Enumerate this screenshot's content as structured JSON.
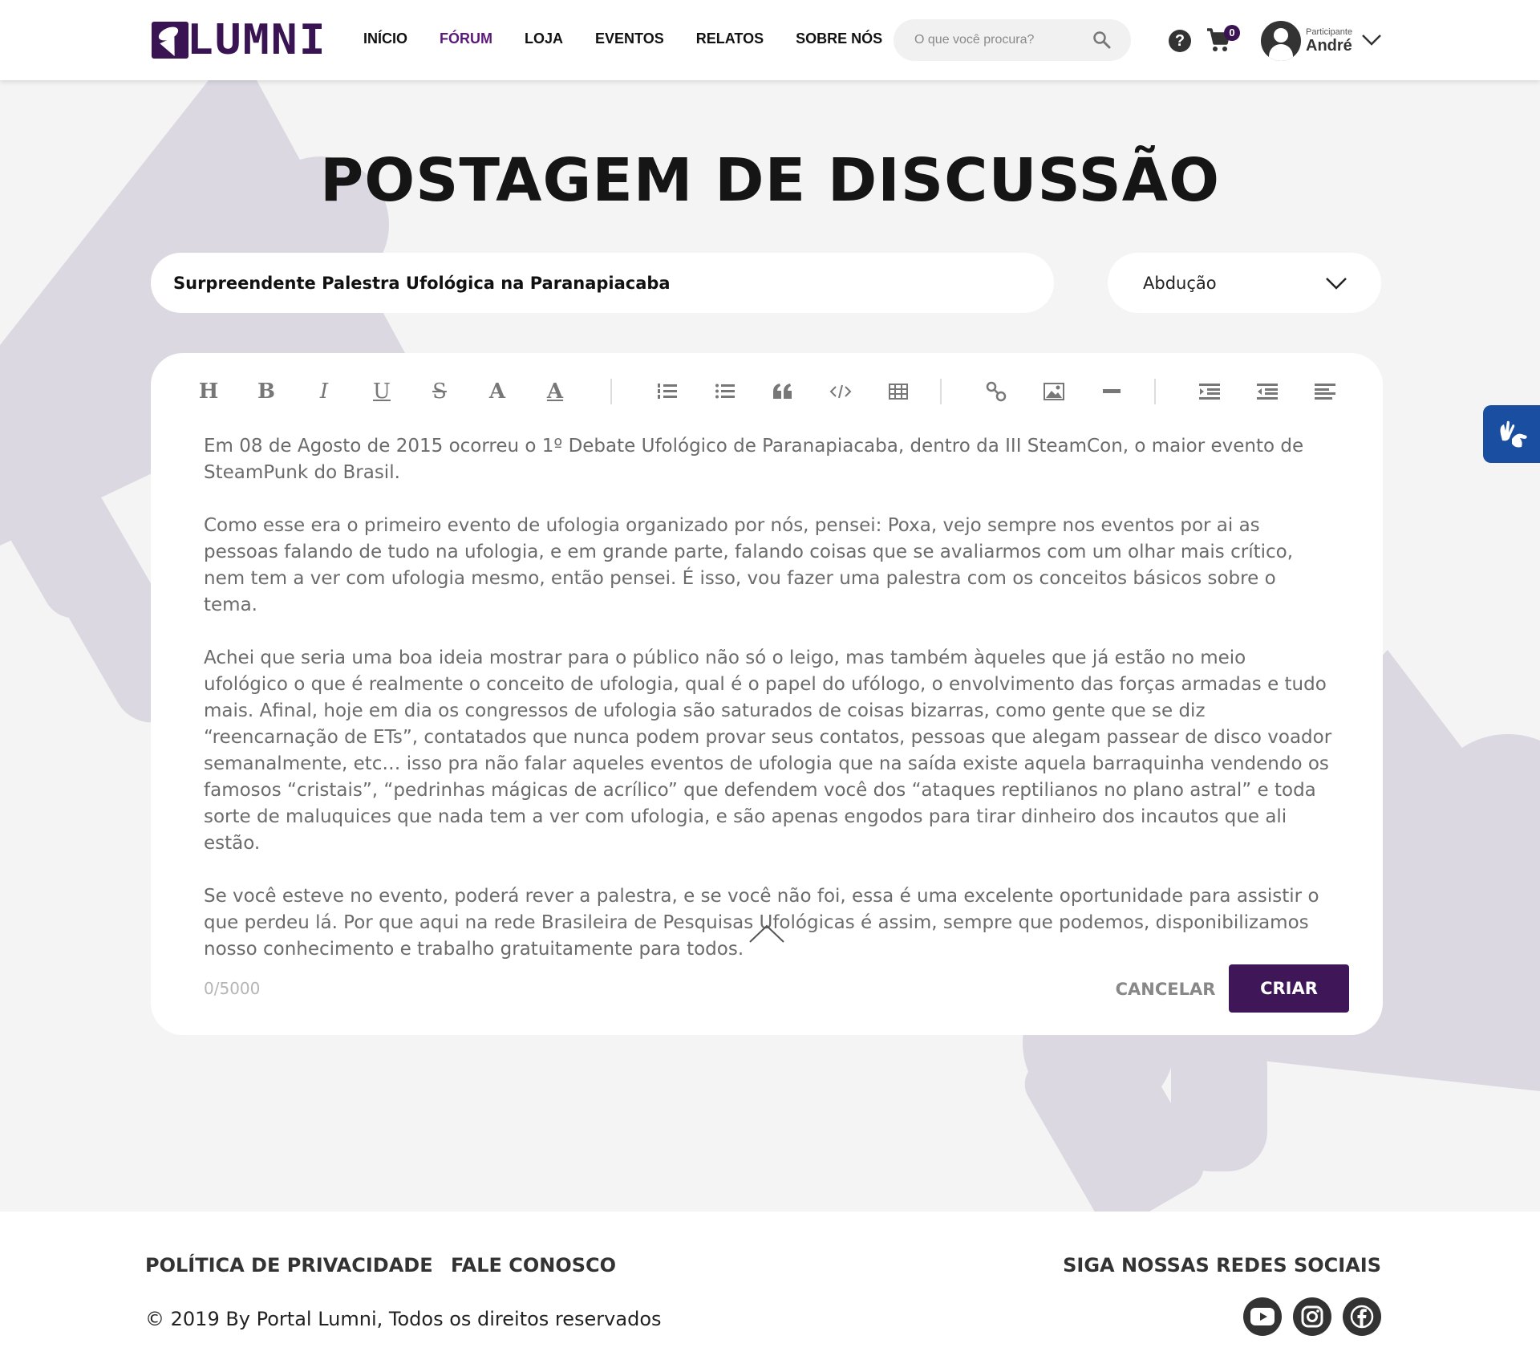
{
  "header": {
    "logo_text": "LUMNI",
    "nav": [
      {
        "label": "INÍCIO"
      },
      {
        "label": "FÓRUM"
      },
      {
        "label": "LOJA"
      },
      {
        "label": "EVENTOS"
      },
      {
        "label": "RELATOS"
      },
      {
        "label": "SOBRE NÓS"
      }
    ],
    "active_nav": "FÓRUM",
    "search_placeholder": "O que você procura?",
    "cart_count": "0",
    "user_role": "Participante",
    "user_name": "André",
    "help_glyph": "?"
  },
  "main": {
    "page_title": "POSTAGEM DE DISCUSSÃO",
    "post_title": "Surpreendente Palestra Ufológica na Paranapiacaba",
    "category": "Abdução",
    "toolbar": {
      "heading": "H",
      "bold": "B",
      "italic": "I",
      "underline": "U",
      "strike": "S",
      "font": "A",
      "font_color": "A"
    },
    "paragraphs": [
      "Em 08 de Agosto de 2015 ocorreu o 1º Debate Ufológico de Paranapiacaba, dentro da III SteamCon, o maior evento de SteamPunk do Brasil.",
      "Como esse era o primeiro evento de ufologia organizado por nós, pensei: Poxa, vejo sempre nos eventos por ai as pessoas falando de tudo na ufologia, e em grande parte, falando coisas que se avaliarmos com um olhar mais crítico, nem tem a ver com ufologia mesmo, então pensei. É isso, vou fazer uma palestra com os conceitos básicos sobre o tema.",
      "Achei que seria uma boa ideia mostrar para o público não só o leigo, mas também àqueles que já estão no meio ufológico o que é realmente o conceito de ufologia, qual é o papel do ufólogo, o envolvimento das forças armadas e tudo mais. Afinal, hoje em dia os congressos de ufologia são saturados de coisas bizarras, como gente que se diz “reencarnação de ETs”, contatados que nunca podem provar seus contatos, pessoas que alegam passear de disco voador semanalmente, etc… isso pra não falar aqueles eventos de ufologia que na saída existe aquela barraquinha vendendo os famosos “cristais”, “pedrinhas mágicas de acrílico” que defendem você dos “ataques reptilianos no plano astral” e toda sorte de maluquices que nada tem a ver com ufologia, e são apenas engodos para tirar dinheiro dos incautos que ali estão.",
      "Se você esteve no evento, poderá rever a palestra, e se você não foi, essa é uma excelente oportunidade para assistir o que perdeu lá. Por que aqui na rede Brasileira de Pesquisas Ufológicas é assim, sempre que podemos, disponibilizamos nosso conhecimento e trabalho gratuitamente para todos."
    ],
    "char_counter": "0/5000",
    "cancel_label": "CANCELAR",
    "create_label": "CRIAR"
  },
  "footer": {
    "privacy_label": "POLÍTICA DE PRIVACIDADE",
    "contact_label": "FALE CONOSCO",
    "social_title": "SIGA NOSSAS REDES SOCIAIS",
    "copyright": "© 2019 By Portal Lumni, Todos os direitos reservados",
    "social": [
      "youtube-icon",
      "instagram-icon",
      "facebook-icon"
    ]
  },
  "colors": {
    "brand": "#3f1759",
    "active_nav": "#5b1a7a",
    "background": "#f4f4f4",
    "art": "#dcd8e2",
    "a11y": "#1a4ea0"
  }
}
